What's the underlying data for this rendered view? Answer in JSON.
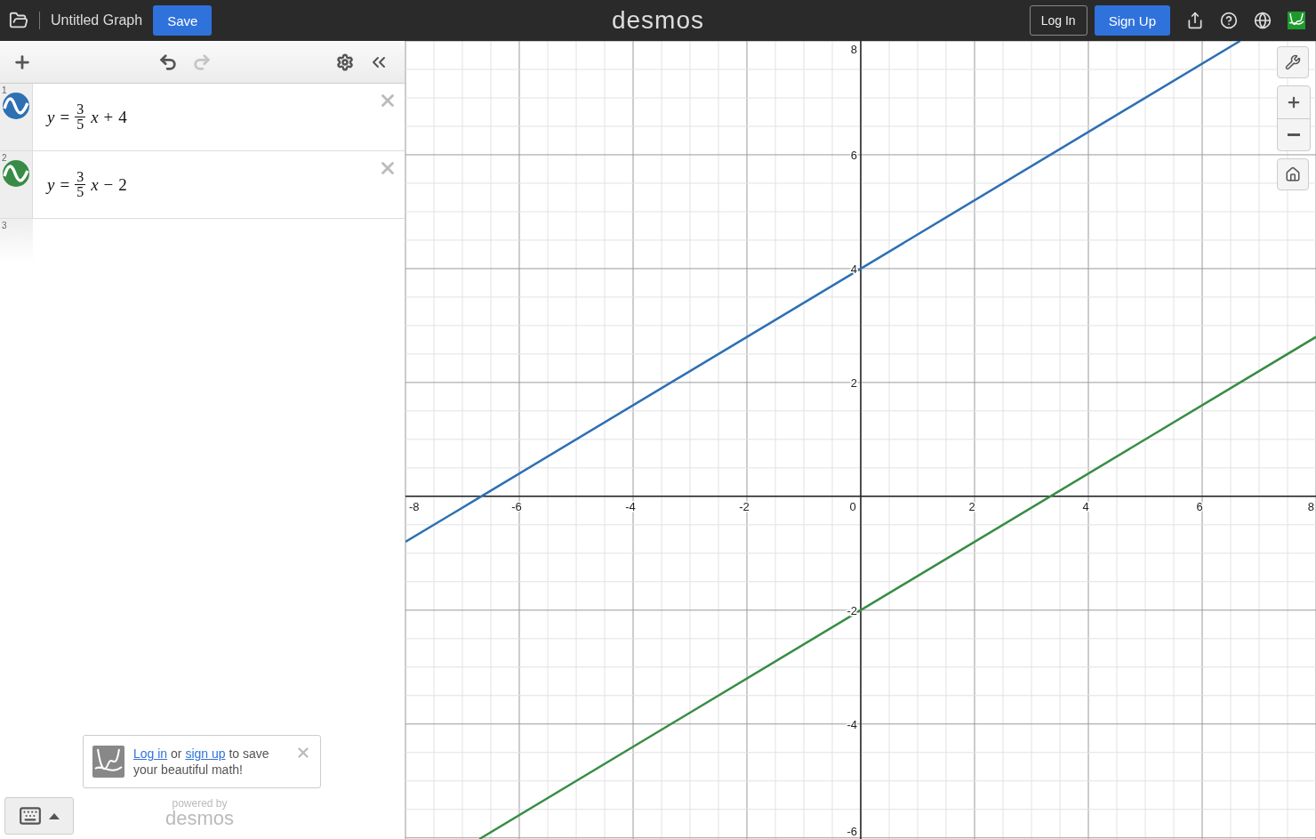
{
  "top_bar": {
    "title": "Untitled Graph",
    "save": "Save",
    "logo": "desmos",
    "login": "Log In",
    "signup": "Sign Up"
  },
  "expressions": [
    {
      "number": "1",
      "color": "#2d70b3",
      "lhs": "y",
      "equals": "=",
      "numerator": "3",
      "denominator": "5",
      "variable": "x",
      "operator": "+",
      "constant": "4"
    },
    {
      "number": "2",
      "color": "#388c46",
      "lhs": "y",
      "equals": "=",
      "numerator": "3",
      "denominator": "5",
      "variable": "x",
      "operator": "−",
      "constant": "2"
    }
  ],
  "empty_row": {
    "number": "3"
  },
  "notice": {
    "login_link": "Log in",
    "middle": " or ",
    "signup_link": "sign up",
    "text": " to save your beautiful math!"
  },
  "powered_by": {
    "label": "powered by",
    "brand": "desmos"
  },
  "graph": {
    "chart_data": {
      "type": "line",
      "x": [
        -8,
        -6.7,
        6.6667,
        8
      ],
      "grid": true,
      "series": [
        {
          "color": "#2d70b3",
          "values": [
            -0.8,
            -0.02,
            8,
            null
          ]
        },
        {
          "color": "#388c46",
          "values": [
            null,
            -6.02,
            2,
            2.8
          ]
        }
      ],
      "xlim": [
        -8,
        8
      ],
      "ylim": [
        -6.02,
        8
      ],
      "xticks": [
        -8,
        -6,
        -4,
        -2,
        0,
        2,
        4,
        6,
        8
      ],
      "yticks": [
        -6,
        -4,
        -2,
        2,
        4,
        6,
        8
      ]
    }
  }
}
